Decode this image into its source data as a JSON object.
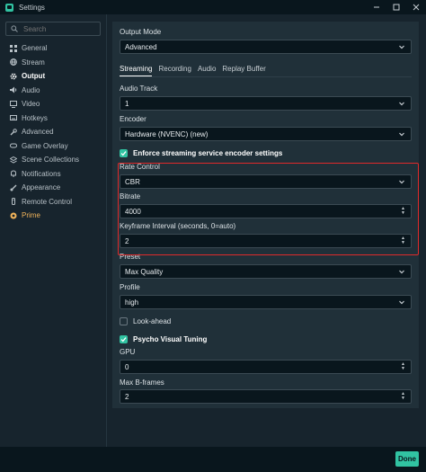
{
  "window": {
    "title": "Settings",
    "controls": [
      "minimize",
      "maximize",
      "close"
    ]
  },
  "search": {
    "placeholder": "Search"
  },
  "sidebar": {
    "items": [
      {
        "label": "General",
        "icon": "grid-icon"
      },
      {
        "label": "Stream",
        "icon": "globe-icon"
      },
      {
        "label": "Output",
        "icon": "gear-icon",
        "active": true
      },
      {
        "label": "Audio",
        "icon": "speaker-icon"
      },
      {
        "label": "Video",
        "icon": "display-icon"
      },
      {
        "label": "Hotkeys",
        "icon": "keyboard-icon"
      },
      {
        "label": "Advanced",
        "icon": "wrench-icon"
      },
      {
        "label": "Game Overlay",
        "icon": "gamepad-icon"
      },
      {
        "label": "Scene Collections",
        "icon": "layers-icon"
      },
      {
        "label": "Notifications",
        "icon": "bell-icon"
      },
      {
        "label": "Appearance",
        "icon": "brush-icon"
      },
      {
        "label": "Remote Control",
        "icon": "remote-icon"
      },
      {
        "label": "Prime",
        "icon": "prime-icon"
      }
    ]
  },
  "output": {
    "mode_label": "Output Mode",
    "mode_value": "Advanced",
    "tabs": [
      "Streaming",
      "Recording",
      "Audio",
      "Replay Buffer"
    ],
    "audio_track_label": "Audio Track",
    "audio_track_value": "1",
    "encoder_label": "Encoder",
    "encoder_value": "Hardware (NVENC) (new)",
    "enforce_label": "Enforce streaming service encoder settings",
    "rate_control_label": "Rate Control",
    "rate_control_value": "CBR",
    "bitrate_label": "Bitrate",
    "bitrate_value": "4000",
    "keyframe_label": "Keyframe Interval (seconds, 0=auto)",
    "keyframe_value": "2",
    "preset_label": "Preset",
    "preset_value": "Max Quality",
    "profile_label": "Profile",
    "profile_value": "high",
    "lookahead_label": "Look-ahead",
    "psycho_label": "Psycho Visual Tuning",
    "gpu_label": "GPU",
    "gpu_value": "0",
    "bframes_label": "Max B-frames",
    "bframes_value": "2"
  },
  "footer": {
    "done_label": "Done"
  },
  "colors": {
    "accent": "#31c3a2",
    "highlight": "#e02a2a",
    "prime": "#f0b35a"
  }
}
